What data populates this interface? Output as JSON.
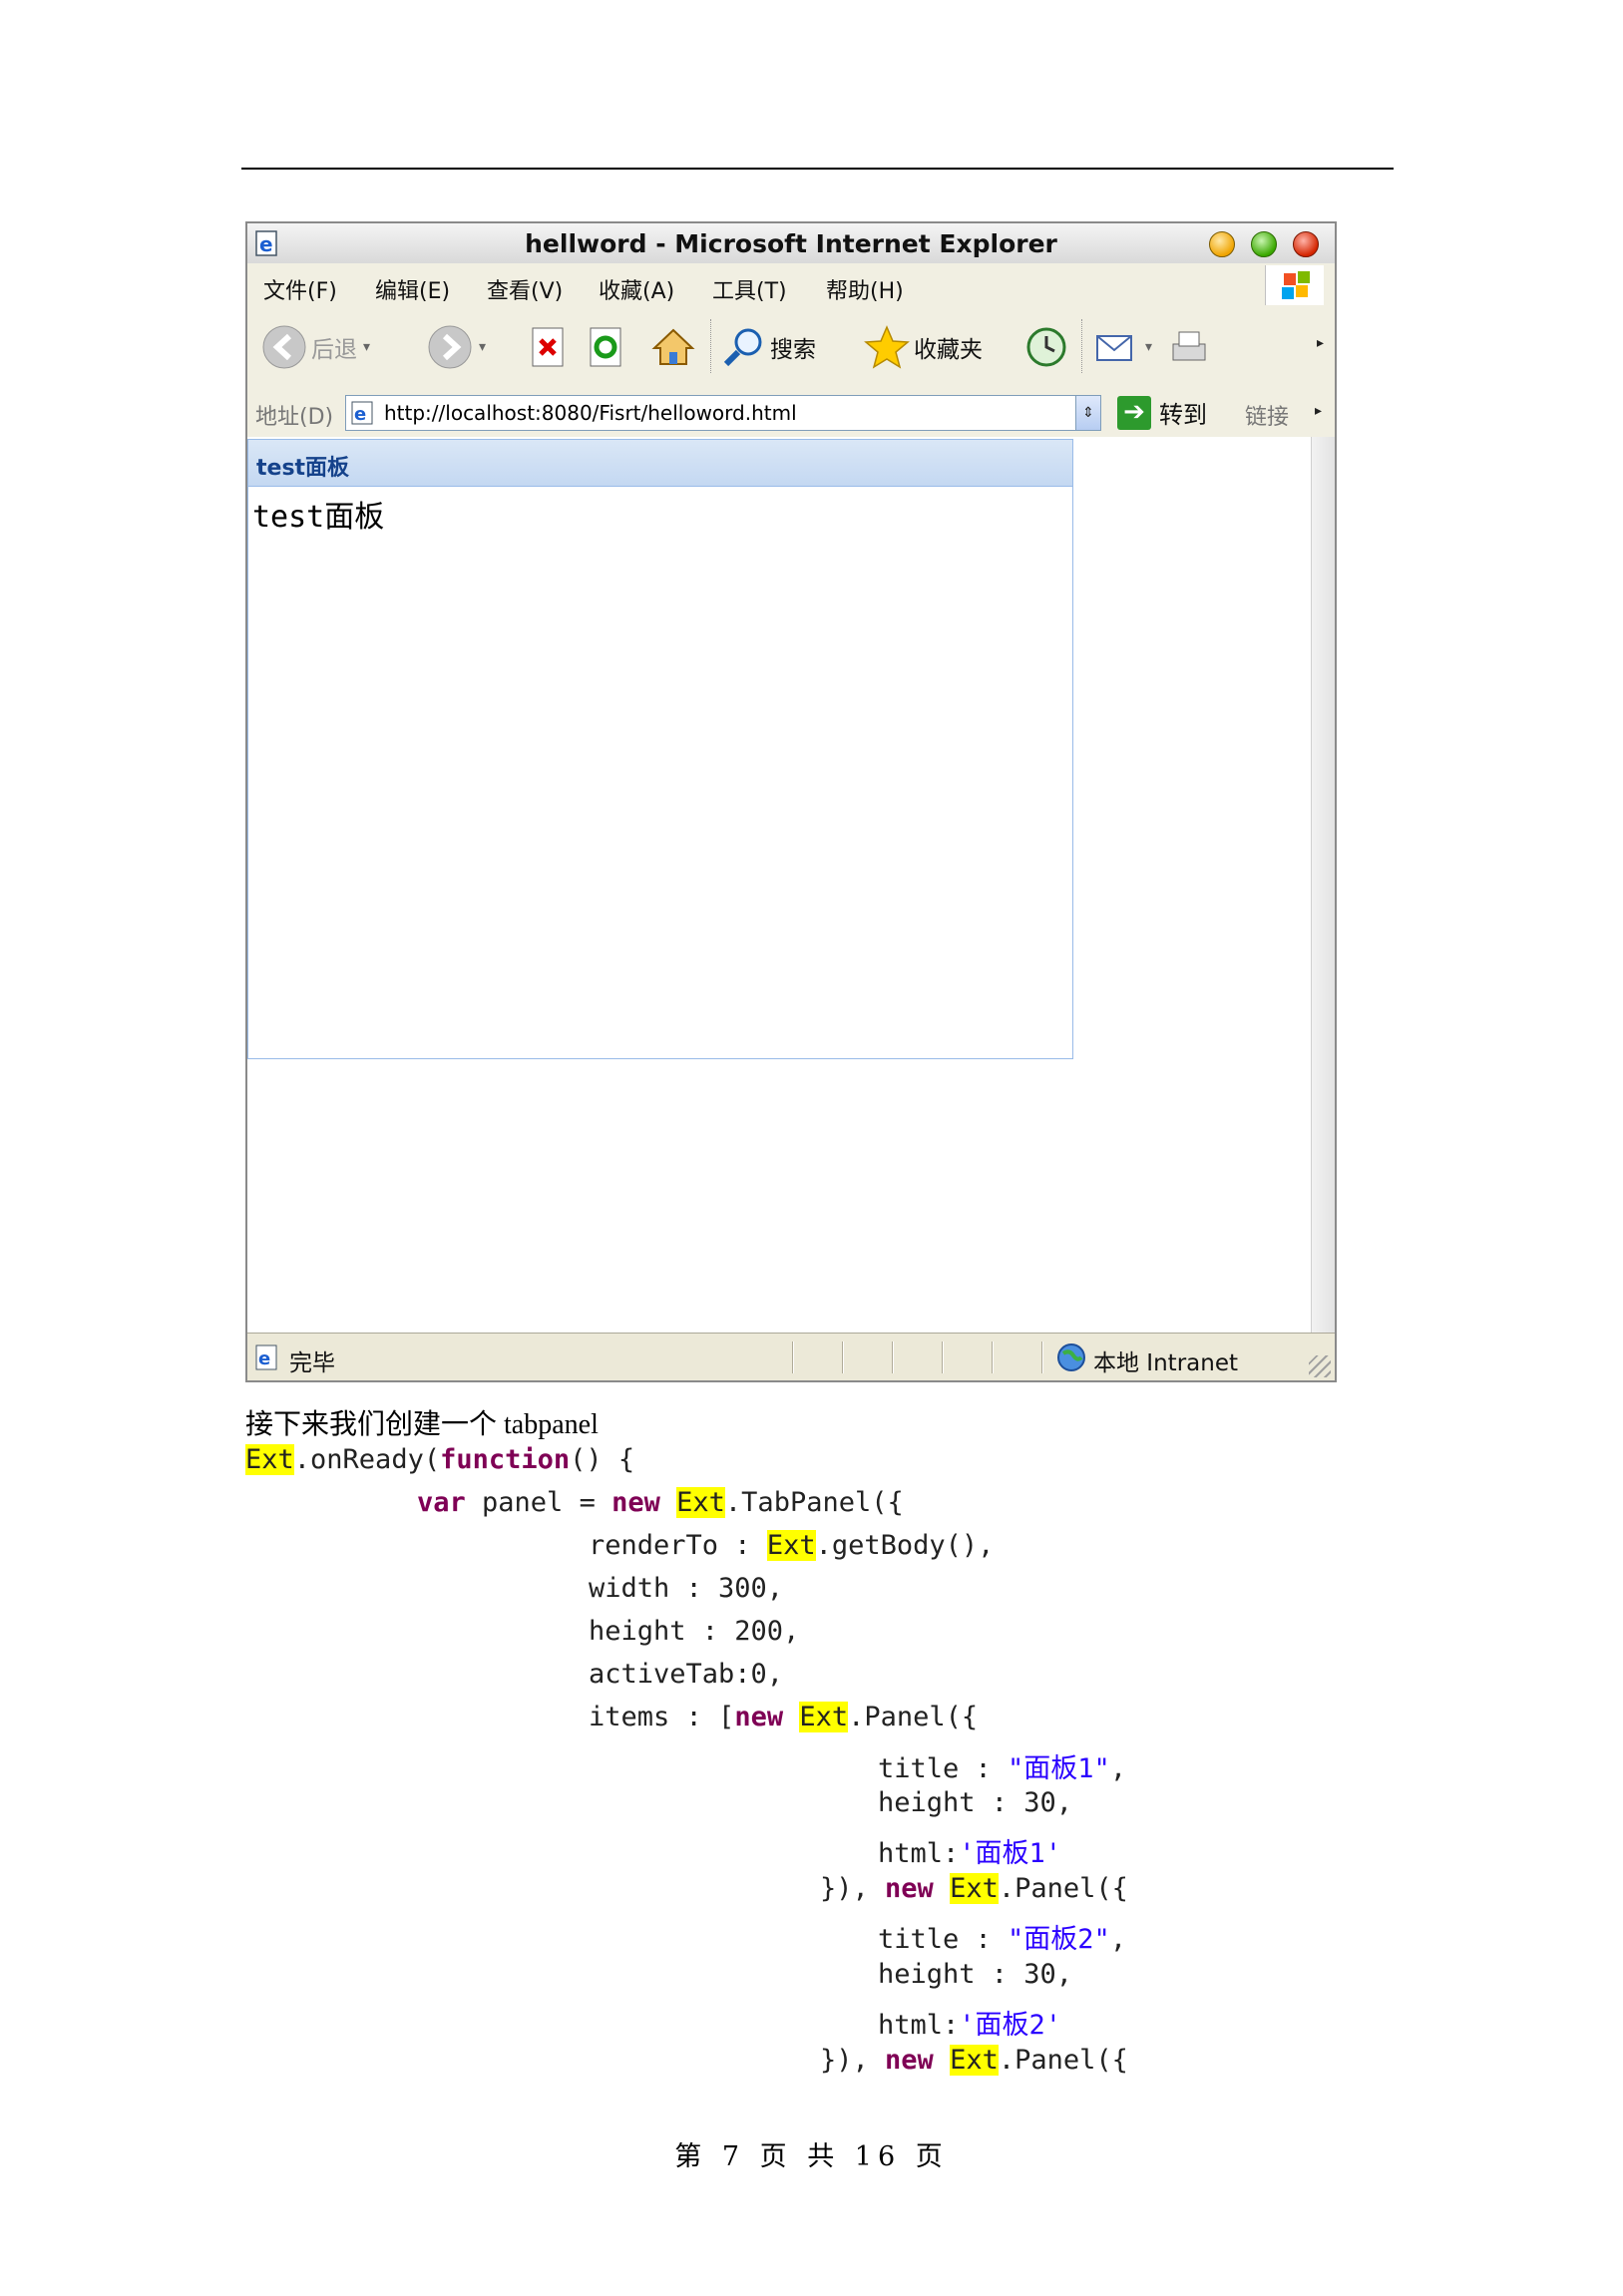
{
  "window": {
    "title": "hellword - Microsoft Internet Explorer"
  },
  "menubar": {
    "items": [
      "文件(F)",
      "编辑(E)",
      "查看(V)",
      "收藏(A)",
      "工具(T)",
      "帮助(H)"
    ]
  },
  "toolbar": {
    "back_label": "后退",
    "search_label": "搜索",
    "favorites_label": "收藏夹"
  },
  "addressbar": {
    "label": "地址(D)",
    "url": "http://localhost:8080/Fisrt/helloword.html",
    "go_label": "转到",
    "links_label": "链接"
  },
  "panel": {
    "title": "test面板",
    "body": "test面板"
  },
  "statusbar": {
    "status": "完毕",
    "zone": "本地 Intranet"
  },
  "document": {
    "intro": "接下来我们创建一个 tabpanel",
    "code_lines": [
      [
        {
          "t": "Ext",
          "c": "hl"
        },
        {
          "t": ".onReady("
        },
        {
          "t": "function",
          "c": "kw"
        },
        {
          "t": "() {"
        }
      ],
      [
        {
          "t": "var",
          "c": "kw"
        },
        {
          "t": " panel = "
        },
        {
          "t": "new",
          "c": "kw"
        },
        {
          "t": " "
        },
        {
          "t": "Ext",
          "c": "hl"
        },
        {
          "t": ".TabPanel({"
        }
      ],
      [
        {
          "t": "renderTo : "
        },
        {
          "t": "Ext",
          "c": "hl"
        },
        {
          "t": ".getBody(),"
        }
      ],
      [
        {
          "t": "width : 300,"
        }
      ],
      [
        {
          "t": "height : 200,"
        }
      ],
      [
        {
          "t": "activeTab:0,"
        }
      ],
      [
        {
          "t": "items : ["
        },
        {
          "t": "new",
          "c": "kw"
        },
        {
          "t": " "
        },
        {
          "t": "Ext",
          "c": "hl"
        },
        {
          "t": ".Panel({"
        }
      ],
      [
        {
          "t": "title : "
        },
        {
          "t": "\"面板1\"",
          "c": "str"
        },
        {
          "t": ","
        }
      ],
      [
        {
          "t": "height : 30,"
        }
      ],
      [
        {
          "t": "html:"
        },
        {
          "t": "'面板1'",
          "c": "str"
        }
      ],
      [
        {
          "t": "}), "
        },
        {
          "t": "new",
          "c": "kw"
        },
        {
          "t": " "
        },
        {
          "t": "Ext",
          "c": "hl"
        },
        {
          "t": ".Panel({"
        }
      ],
      [
        {
          "t": "title : "
        },
        {
          "t": "\"面板2\"",
          "c": "str"
        },
        {
          "t": ","
        }
      ],
      [
        {
          "t": "height : 30,"
        }
      ],
      [
        {
          "t": "html:"
        },
        {
          "t": "'面板2'",
          "c": "str"
        }
      ],
      [
        {
          "t": "}), "
        },
        {
          "t": "new",
          "c": "kw"
        },
        {
          "t": " "
        },
        {
          "t": "Ext",
          "c": "hl"
        },
        {
          "t": ".Panel({"
        }
      ]
    ],
    "page_footer": "第 7 页 共 16 页"
  },
  "colors": {
    "keyword": "#7f0055",
    "highlight": "#ffff00",
    "string": "#2a00ff",
    "panel_title": "#15428b"
  }
}
